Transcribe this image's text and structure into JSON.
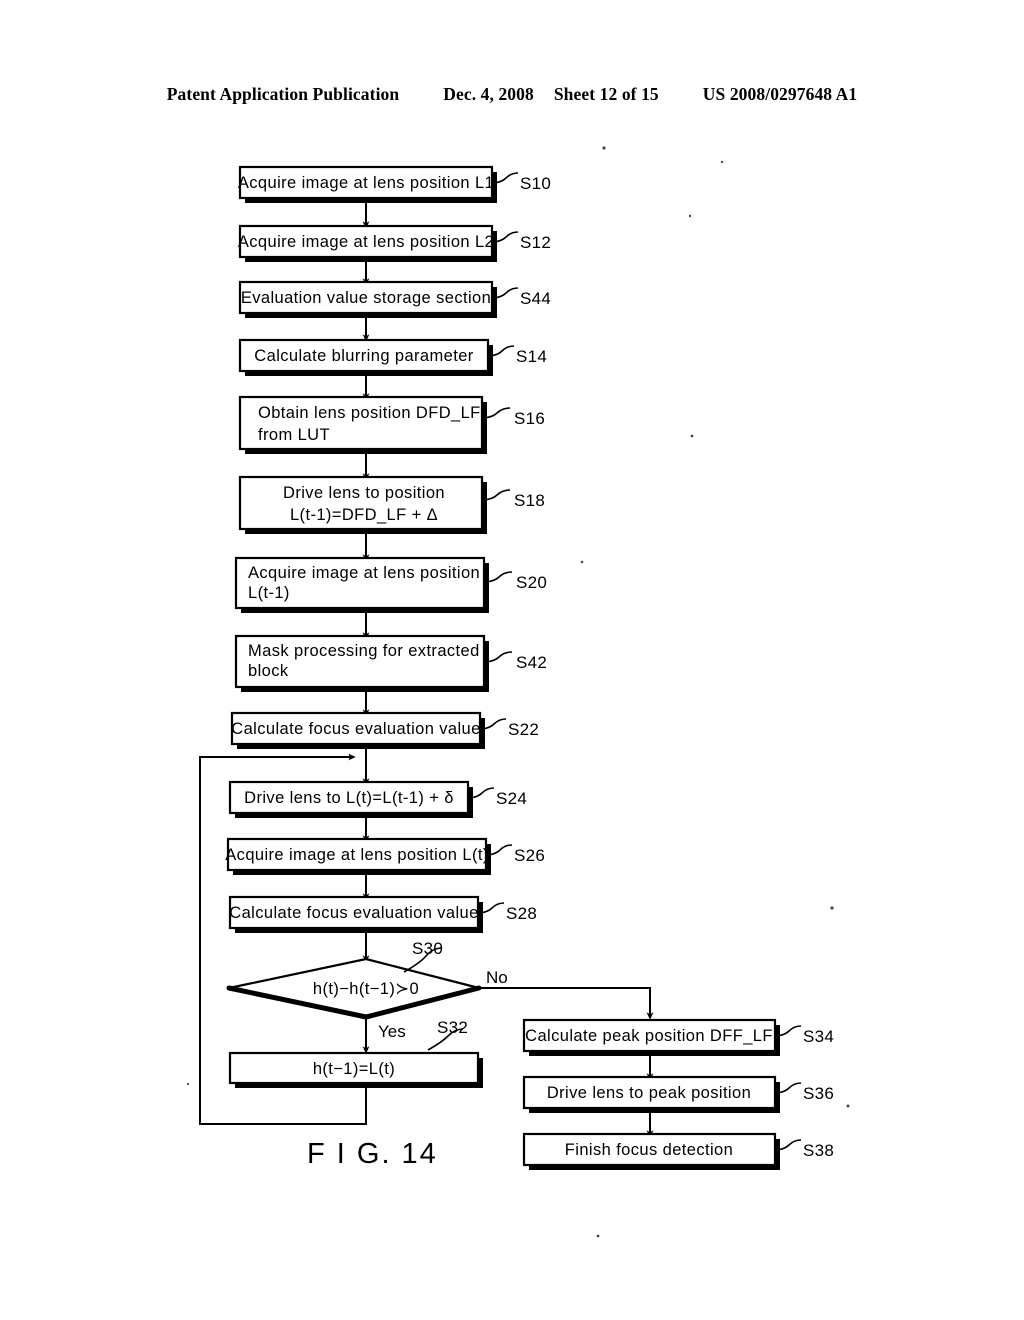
{
  "header": {
    "publication": "Patent Application Publication",
    "date": "Dec. 4, 2008",
    "sheet": "Sheet 12 of 15",
    "patent_number": "US 2008/0297648 A1"
  },
  "figure": {
    "caption": "F I G. 14",
    "type": "flowchart",
    "branch_labels": {
      "yes": "Yes",
      "no": "No"
    },
    "nodes": [
      {
        "id": "S10",
        "step": "S10",
        "shape": "process",
        "lines": [
          "Acquire image at lens position L1"
        ]
      },
      {
        "id": "S12",
        "step": "S12",
        "shape": "process",
        "lines": [
          "Acquire image at lens position L2"
        ]
      },
      {
        "id": "S44",
        "step": "S44",
        "shape": "process",
        "lines": [
          "Evaluation value storage section"
        ]
      },
      {
        "id": "S14",
        "step": "S14",
        "shape": "process",
        "lines": [
          "Calculate blurring parameter"
        ]
      },
      {
        "id": "S16",
        "step": "S16",
        "shape": "process",
        "lines": [
          "Obtain lens position DFD_LF",
          "from LUT"
        ]
      },
      {
        "id": "S18",
        "step": "S18",
        "shape": "process",
        "lines": [
          "Drive lens to position",
          "L(t-1)=DFD_LF + Δ"
        ]
      },
      {
        "id": "S20",
        "step": "S20",
        "shape": "process",
        "lines": [
          "Acquire image at lens position",
          "L(t-1)"
        ]
      },
      {
        "id": "S42",
        "step": "S42",
        "shape": "process",
        "lines": [
          "Mask processing for extracted",
          "block"
        ]
      },
      {
        "id": "S22",
        "step": "S22",
        "shape": "process",
        "lines": [
          "Calculate focus evaluation value"
        ]
      },
      {
        "id": "S24",
        "step": "S24",
        "shape": "process",
        "lines": [
          "Drive lens to L(t)=L(t-1) + δ"
        ]
      },
      {
        "id": "S26",
        "step": "S26",
        "shape": "process",
        "lines": [
          "Acquire image at lens position L(t)"
        ]
      },
      {
        "id": "S28",
        "step": "S28",
        "shape": "process",
        "lines": [
          "Calculate focus evaluation value"
        ]
      },
      {
        "id": "S30",
        "step": "S30",
        "shape": "decision",
        "lines": [
          "h(t)−h(t−1)≻0"
        ]
      },
      {
        "id": "S32",
        "step": "S32",
        "shape": "process",
        "lines": [
          "h(t−1)=L(t)"
        ]
      },
      {
        "id": "S34",
        "step": "S34",
        "shape": "process",
        "lines": [
          "Calculate peak position DFF_LF"
        ]
      },
      {
        "id": "S36",
        "step": "S36",
        "shape": "process",
        "lines": [
          "Drive lens to peak position"
        ]
      },
      {
        "id": "S38",
        "step": "S38",
        "shape": "process",
        "lines": [
          "Finish focus detection"
        ]
      }
    ]
  }
}
